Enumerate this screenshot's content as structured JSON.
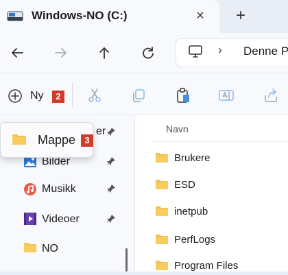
{
  "tab": {
    "title": "Windows-NO (C:)",
    "close_icon": "×",
    "new_tab_icon": "+"
  },
  "address": {
    "segments": [
      "Denne P"
    ],
    "chevron": "›"
  },
  "commands": {
    "new_label": "Ny",
    "new_badge": "2"
  },
  "menu": {
    "item_label": "Mappe",
    "item_badge": "3",
    "hidden_text": "er"
  },
  "sidebar": {
    "items": [
      {
        "label": "Bilder",
        "icon": "pictures-icon",
        "pinned": true
      },
      {
        "label": "Musikk",
        "icon": "music-icon",
        "pinned": true
      },
      {
        "label": "Videoer",
        "icon": "videos-icon",
        "pinned": true
      },
      {
        "label": "NO",
        "icon": "folder-icon",
        "pinned": false
      }
    ]
  },
  "main": {
    "column_header": "Navn",
    "files": [
      "Brukere",
      "ESD",
      "inetpub",
      "PerfLogs",
      "Program Files"
    ]
  },
  "colors": {
    "accent": "#0a5fb4",
    "folder": "#f4c24d",
    "badge": "#d23a2a"
  }
}
